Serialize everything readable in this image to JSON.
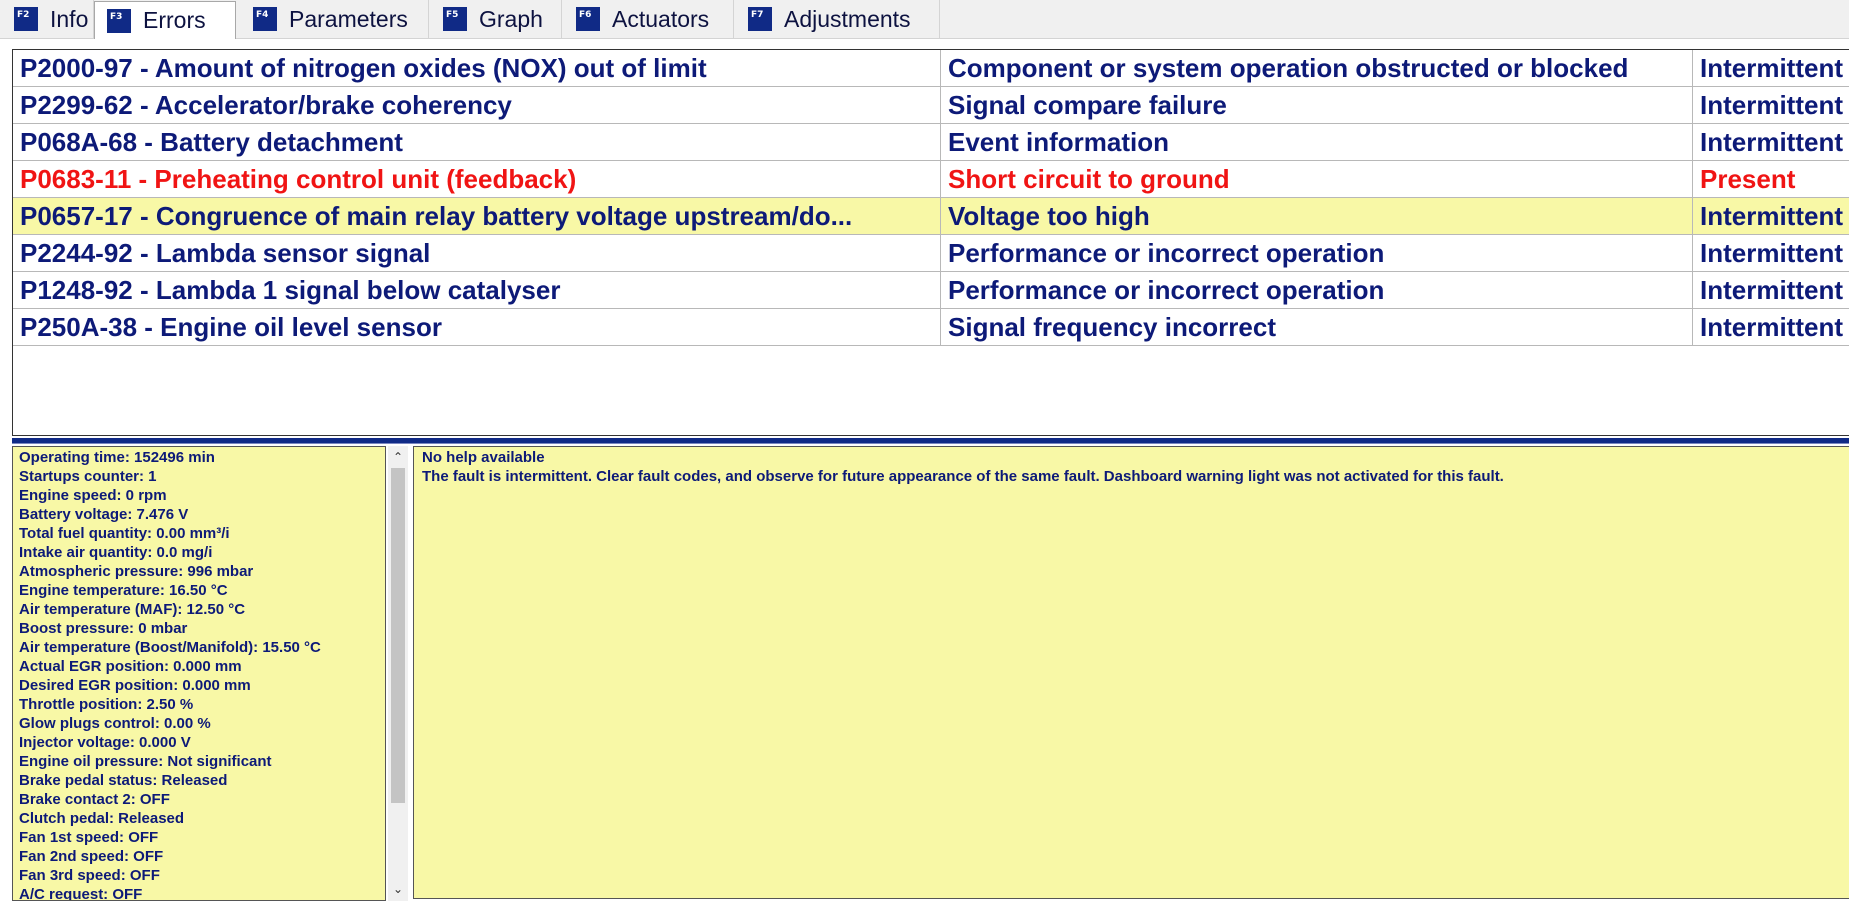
{
  "tabs": [
    {
      "key": "F2",
      "label": "Info"
    },
    {
      "key": "F3",
      "label": "Errors"
    },
    {
      "key": "F4",
      "label": "Parameters"
    },
    {
      "key": "F5",
      "label": "Graph"
    },
    {
      "key": "F6",
      "label": "Actuators"
    },
    {
      "key": "F7",
      "label": "Adjustments"
    }
  ],
  "active_tab": "Errors",
  "errors": [
    {
      "code": "P2000-97 - Amount of nitrogen oxides (NOX) out of limit",
      "description": "Component or system operation obstructed or blocked",
      "status": "Intermittent"
    },
    {
      "code": "P2299-62 - Accelerator/brake coherency",
      "description": "Signal compare failure",
      "status": "Intermittent"
    },
    {
      "code": "P068A-68 - Battery detachment",
      "description": "Event information",
      "status": "Intermittent"
    },
    {
      "code": "P0683-11 - Preheating control unit (feedback)",
      "description": "Short circuit to ground",
      "status": "Present"
    },
    {
      "code": "P0657-17 - Congruence of main relay battery voltage upstream/do...",
      "description": "Voltage too high",
      "status": "Intermittent"
    },
    {
      "code": "P2244-92 - Lambda sensor signal",
      "description": "Performance or incorrect operation",
      "status": "Intermittent"
    },
    {
      "code": "P1248-92 - Lambda 1 signal below catalyser",
      "description": "Performance or incorrect operation",
      "status": "Intermittent"
    },
    {
      "code": "P250A-38 - Engine oil level sensor",
      "description": "Signal frequency incorrect",
      "status": "Intermittent"
    }
  ],
  "selected_error_index": 4,
  "parameters": [
    "Operating time: 152496 min",
    "Startups counter: 1",
    "Engine speed: 0 rpm",
    "Battery voltage: 7.476 V",
    "Total fuel quantity: 0.00 mm³/i",
    "Intake air quantity: 0.0 mg/i",
    "Atmospheric pressure: 996 mbar",
    "Engine temperature: 16.50 °C",
    "Air temperature (MAF): 12.50 °C",
    "Boost pressure: 0 mbar",
    "Air temperature (Boost/Manifold): 15.50 °C",
    "Actual EGR position: 0.000 mm",
    "Desired EGR position: 0.000 mm",
    "Throttle position: 2.50 %",
    "Glow plugs control: 0.00 %",
    "Injector voltage: 0.000 V",
    "Engine oil pressure: Not significant",
    "Brake pedal status: Released",
    "Brake contact 2: OFF",
    "Clutch pedal: Released",
    "Fan 1st speed: OFF",
    "Fan 2nd speed: OFF",
    "Fan 3rd speed: OFF",
    "A/C request: OFF"
  ],
  "help": {
    "title": "No help available",
    "text": "The fault is intermittent. Clear fault codes, and observe for future appearance of the same fault. Dashboard warning light was not activated for this fault."
  },
  "scrollbar": {
    "up_icon": "chevron-up-icon",
    "down_icon": "chevron-down-icon"
  },
  "colors": {
    "text": "#0d1a78",
    "present": "#f01414",
    "selected_row": "#f8f8a6",
    "panel_yellow": "#f8f8a6",
    "fkey_badge": "#102a86"
  }
}
